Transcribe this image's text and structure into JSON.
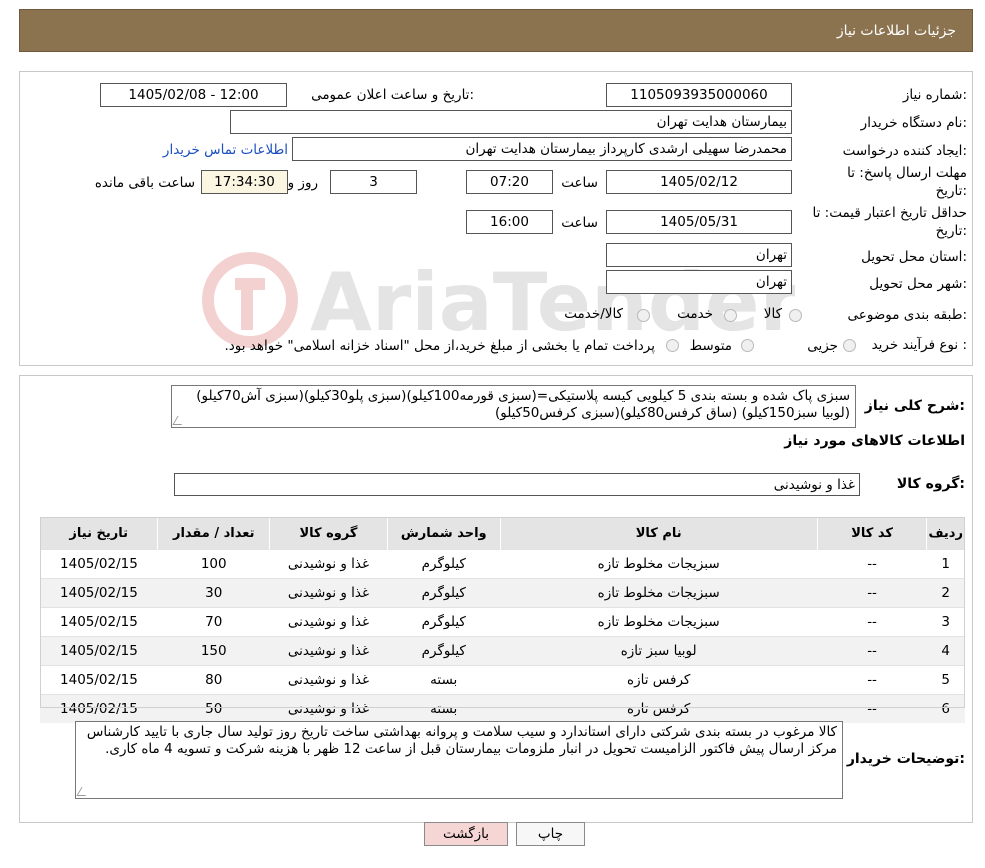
{
  "header": {
    "title": "جزئیات اطلاعات نیاز"
  },
  "form": {
    "need_number_label": "شماره نیاز:",
    "need_number": "1105093935000060",
    "announce_label": "تاریخ و ساعت اعلان عمومی:",
    "announce_value": "1405/02/08 - 12:00",
    "buyer_org_label": "نام دستگاه خریدار:",
    "buyer_org": "بیمارستان هدایت تهران",
    "requester_label": "ایجاد کننده درخواست:",
    "requester": "محمدرضا سهیلی ارشدی کارپرداز بیمارستان هدایت تهران",
    "contact_link": "اطلاعات تماس خریدار",
    "deadline_label_1": "مهلت ارسال پاسخ: تا",
    "deadline_label_2": "تاریخ:",
    "deadline_date": "1405/02/12",
    "time_label": "ساعت",
    "deadline_time": "07:20",
    "days_value": "3",
    "days_label": "روز و",
    "remaining_time": "17:34:30",
    "remaining_label": "ساعت باقی مانده",
    "validity_label_1": "حداقل تاریخ اعتبار قیمت: تا",
    "validity_label_2": "تاریخ:",
    "validity_date": "1405/05/31",
    "validity_time_label": "ساعت",
    "validity_time": "16:00",
    "province_label": "استان محل تحویل:",
    "province": "تهران",
    "city_label": "شهر محل تحویل:",
    "city": "تهران",
    "category_label": "طبقه بندی موضوعی:",
    "category_options": [
      "کالا",
      "خدمت",
      "کالا/خدمت"
    ],
    "process_label": "نوع فرآیند خرید :",
    "process_options": [
      "جزیی",
      "متوسط"
    ],
    "process_note": "پرداخت تمام یا بخشی از مبلغ خرید،از محل \"اسناد خزانه اسلامی\" خواهد بود."
  },
  "watermark": {
    "text": "AriaTender.neT"
  },
  "description": {
    "label": "شرح کلی نیاز:",
    "text": "سبزی پاک شده و بسته بندی 5 کیلویی کیسه پلاستیکی=(سبزی قورمه100کیلو)(سبزی پلو30کیلو)(سبزی آش70کیلو)(لوبیا سبز150کیلو) (ساق کرفس80کیلو)(سبزی کرفس50کیلو)"
  },
  "goods": {
    "section_title": "اطلاعات کالاهای مورد نیاز",
    "group_label": "گروه کالا:",
    "group_value": "غذا و نوشیدنی",
    "columns": [
      "ردیف",
      "کد کالا",
      "نام کالا",
      "واحد شمارش",
      "گروه کالا",
      "تعداد / مقدار",
      "تاریخ نیاز"
    ],
    "rows": [
      [
        "1",
        "--",
        "سبزیجات مخلوط تازه",
        "کیلوگرم",
        "غذا و نوشیدنی",
        "100",
        "1405/02/15"
      ],
      [
        "2",
        "--",
        "سبزیجات مخلوط تازه",
        "کیلوگرم",
        "غذا و نوشیدنی",
        "30",
        "1405/02/15"
      ],
      [
        "3",
        "--",
        "سبزیجات مخلوط تازه",
        "کیلوگرم",
        "غذا و نوشیدنی",
        "70",
        "1405/02/15"
      ],
      [
        "4",
        "--",
        "لوبیا سبز تازه",
        "کیلوگرم",
        "غذا و نوشیدنی",
        "150",
        "1405/02/15"
      ],
      [
        "5",
        "--",
        "کرفس تازه",
        "بسته",
        "غذا و نوشیدنی",
        "80",
        "1405/02/15"
      ],
      [
        "6",
        "--",
        "کرفس تازه",
        "بسته",
        "غذا و نوشیدنی",
        "50",
        "1405/02/15"
      ]
    ]
  },
  "buyer_notes": {
    "label": "توضیحات خریدار:",
    "text": "کالا مرغوب در بسته بندی شرکتی دارای استاندارد و سیب سلامت و پروانه بهداشتی ساخت تاریخ روز تولید سال جاری با تایید کارشناس مرکز ارسال پیش فاکتور الزامیست تحویل در انبار ملزومات بیمارستان قبل از ساعت 12 ظهر  با هزینه شرکت و تسویه 4 ماه کاری."
  },
  "buttons": {
    "print": "چاپ",
    "back": "بازگشت"
  },
  "colors": {
    "header_bg": "#8b7350",
    "link": "#1a4fbf",
    "back_button_bg": "#f6d5d5"
  }
}
